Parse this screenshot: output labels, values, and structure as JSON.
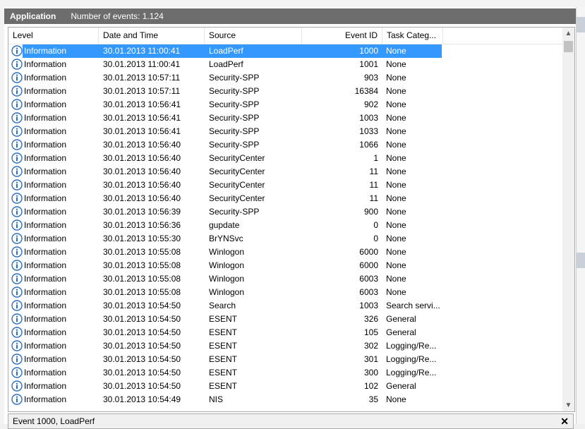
{
  "header": {
    "title": "Application",
    "count_label": "Number of events: 1.124"
  },
  "columns": [
    {
      "key": "level",
      "label": "Level"
    },
    {
      "key": "date",
      "label": "Date and Time"
    },
    {
      "key": "source",
      "label": "Source"
    },
    {
      "key": "eventid",
      "label": "Event ID"
    },
    {
      "key": "task",
      "label": "Task Categ..."
    }
  ],
  "rows": [
    {
      "level": "Information",
      "date": "30.01.2013 11:00:41",
      "source": "LoadPerf",
      "eventid": "1000",
      "task": "None",
      "selected": true
    },
    {
      "level": "Information",
      "date": "30.01.2013 11:00:41",
      "source": "LoadPerf",
      "eventid": "1001",
      "task": "None"
    },
    {
      "level": "Information",
      "date": "30.01.2013 10:57:11",
      "source": "Security-SPP",
      "eventid": "903",
      "task": "None"
    },
    {
      "level": "Information",
      "date": "30.01.2013 10:57:11",
      "source": "Security-SPP",
      "eventid": "16384",
      "task": "None"
    },
    {
      "level": "Information",
      "date": "30.01.2013 10:56:41",
      "source": "Security-SPP",
      "eventid": "902",
      "task": "None"
    },
    {
      "level": "Information",
      "date": "30.01.2013 10:56:41",
      "source": "Security-SPP",
      "eventid": "1003",
      "task": "None"
    },
    {
      "level": "Information",
      "date": "30.01.2013 10:56:41",
      "source": "Security-SPP",
      "eventid": "1033",
      "task": "None"
    },
    {
      "level": "Information",
      "date": "30.01.2013 10:56:40",
      "source": "Security-SPP",
      "eventid": "1066",
      "task": "None"
    },
    {
      "level": "Information",
      "date": "30.01.2013 10:56:40",
      "source": "SecurityCenter",
      "eventid": "1",
      "task": "None"
    },
    {
      "level": "Information",
      "date": "30.01.2013 10:56:40",
      "source": "SecurityCenter",
      "eventid": "11",
      "task": "None"
    },
    {
      "level": "Information",
      "date": "30.01.2013 10:56:40",
      "source": "SecurityCenter",
      "eventid": "11",
      "task": "None"
    },
    {
      "level": "Information",
      "date": "30.01.2013 10:56:40",
      "source": "SecurityCenter",
      "eventid": "11",
      "task": "None"
    },
    {
      "level": "Information",
      "date": "30.01.2013 10:56:39",
      "source": "Security-SPP",
      "eventid": "900",
      "task": "None"
    },
    {
      "level": "Information",
      "date": "30.01.2013 10:56:36",
      "source": "gupdate",
      "eventid": "0",
      "task": "None"
    },
    {
      "level": "Information",
      "date": "30.01.2013 10:55:30",
      "source": "BrYNSvc",
      "eventid": "0",
      "task": "None"
    },
    {
      "level": "Information",
      "date": "30.01.2013 10:55:08",
      "source": "Winlogon",
      "eventid": "6000",
      "task": "None"
    },
    {
      "level": "Information",
      "date": "30.01.2013 10:55:08",
      "source": "Winlogon",
      "eventid": "6000",
      "task": "None"
    },
    {
      "level": "Information",
      "date": "30.01.2013 10:55:08",
      "source": "Winlogon",
      "eventid": "6003",
      "task": "None"
    },
    {
      "level": "Information",
      "date": "30.01.2013 10:55:08",
      "source": "Winlogon",
      "eventid": "6003",
      "task": "None"
    },
    {
      "level": "Information",
      "date": "30.01.2013 10:54:50",
      "source": "Search",
      "eventid": "1003",
      "task": "Search servi..."
    },
    {
      "level": "Information",
      "date": "30.01.2013 10:54:50",
      "source": "ESENT",
      "eventid": "326",
      "task": "General"
    },
    {
      "level": "Information",
      "date": "30.01.2013 10:54:50",
      "source": "ESENT",
      "eventid": "105",
      "task": "General"
    },
    {
      "level": "Information",
      "date": "30.01.2013 10:54:50",
      "source": "ESENT",
      "eventid": "302",
      "task": "Logging/Re..."
    },
    {
      "level": "Information",
      "date": "30.01.2013 10:54:50",
      "source": "ESENT",
      "eventid": "301",
      "task": "Logging/Re..."
    },
    {
      "level": "Information",
      "date": "30.01.2013 10:54:50",
      "source": "ESENT",
      "eventid": "300",
      "task": "Logging/Re..."
    },
    {
      "level": "Information",
      "date": "30.01.2013 10:54:50",
      "source": "ESENT",
      "eventid": "102",
      "task": "General"
    },
    {
      "level": "Information",
      "date": "30.01.2013 10:54:49",
      "source": "NIS",
      "eventid": "35",
      "task": "None"
    }
  ],
  "detail": {
    "title": "Event 1000, LoadPerf",
    "close_glyph": "✕"
  },
  "scrollbar": {
    "up_glyph": "▲",
    "down_glyph": "▼"
  },
  "icons": {
    "level_icon": "information-icon",
    "close_icon": "close-icon"
  },
  "colors": {
    "selection": "#3399ff",
    "header_bar": "#6d6d6d",
    "info_icon": "#2c6fbb"
  }
}
